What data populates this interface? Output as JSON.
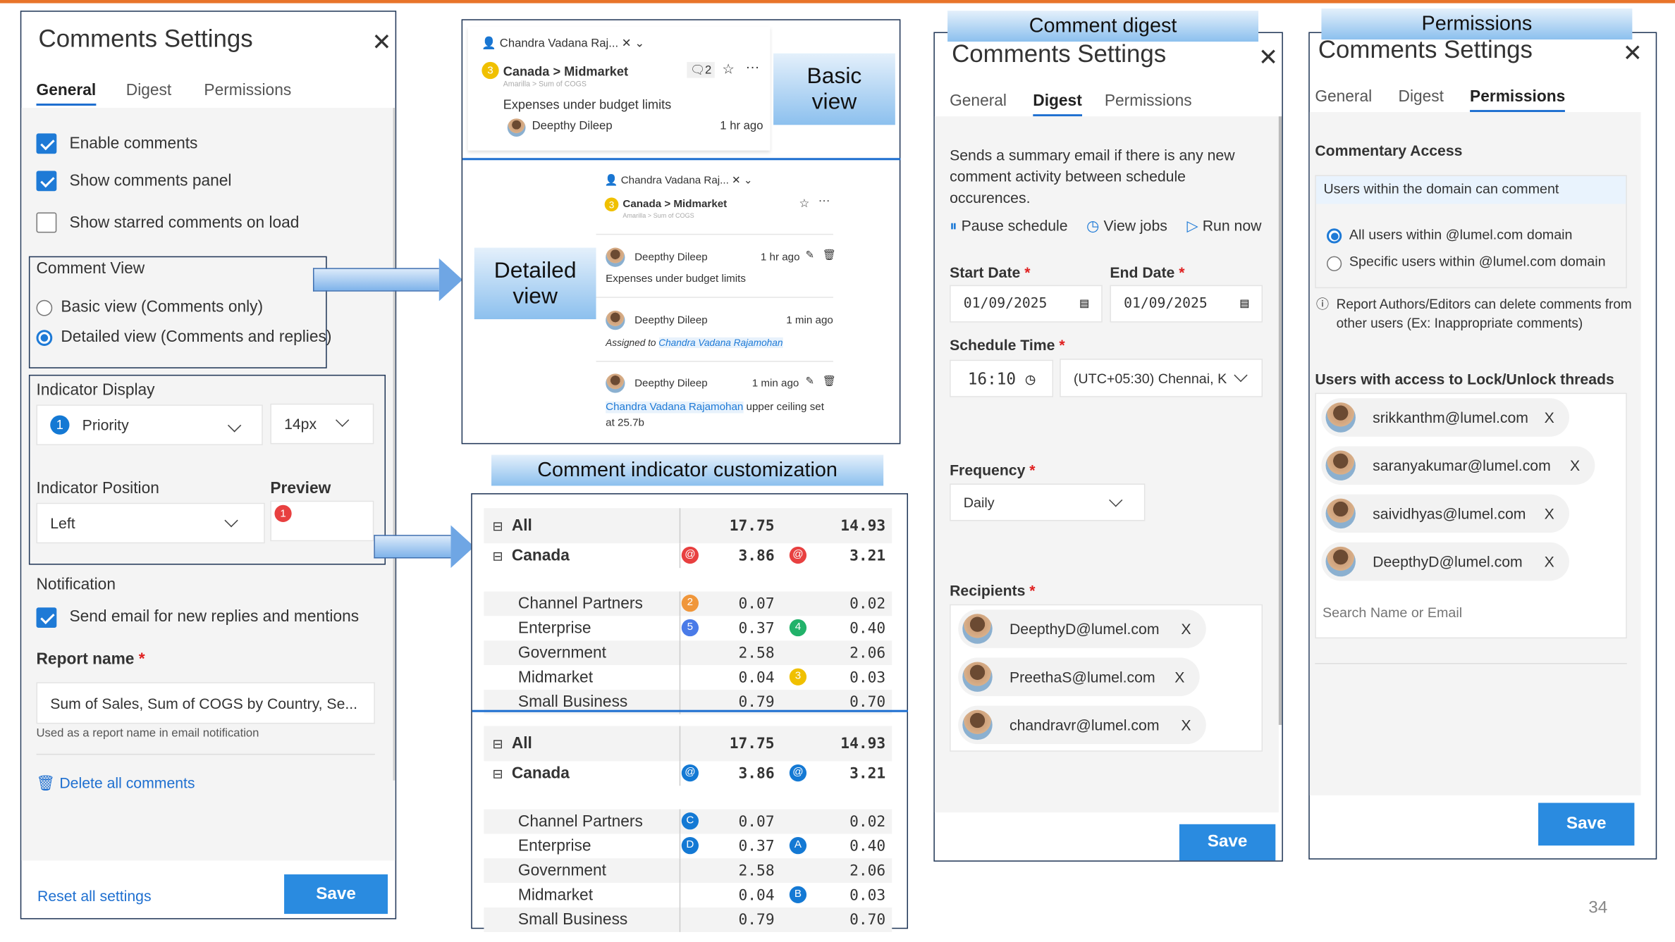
{
  "colors": {
    "accent": "#1e7ad6",
    "save": "#2a8be0",
    "top_line": "#e8742a",
    "callout": "#8cc0ee"
  },
  "general_panel": {
    "title": "Comments Settings",
    "tabs": [
      "General",
      "Digest",
      "Permissions"
    ],
    "active_tab": "General",
    "checkboxes": [
      {
        "label": "Enable comments",
        "checked": true
      },
      {
        "label": "Show comments panel",
        "checked": true
      },
      {
        "label": "Show starred comments on load",
        "checked": false
      }
    ],
    "comment_view": {
      "title": "Comment View",
      "options": [
        {
          "label": "Basic view (Comments only)",
          "selected": false
        },
        {
          "label": "Detailed view (Comments and replies)",
          "selected": true
        }
      ]
    },
    "indicator_display": {
      "title": "Indicator Display",
      "type_value": "Priority",
      "type_badge": "1",
      "size_value": "14px"
    },
    "indicator_position": {
      "title": "Indicator Position",
      "value": "Left",
      "preview_label": "Preview",
      "preview_badge": "1"
    },
    "notification": {
      "title": "Notification",
      "checkbox_label": "Send email for new replies and mentions",
      "checked": true
    },
    "report_name": {
      "label": "Report name",
      "required": "*",
      "value": "Sum of  Sales, Sum of COGS by Country, Se...",
      "hint": "Used as a report name in email notification"
    },
    "delete_all": "Delete all comments",
    "reset": "Reset all settings",
    "save": "Save"
  },
  "views": {
    "basic_label_1": "Basic",
    "basic_label_2": "view",
    "detailed_label_1": "Detailed",
    "detailed_label_2": "view",
    "assignee": "Chandra Vadana Raj...",
    "breadcrumb": "Canada > Midmarket",
    "sub_breadcrumb": "Amarilla > Sum of COGS",
    "priority_badge": "3",
    "reply_count": "2",
    "basic_comment": {
      "text": "Expenses under budget limits",
      "author": "Deepthy Dileep",
      "time": "1 hr ago"
    },
    "detailed_comments": [
      {
        "author": "Deepthy Dileep",
        "time": "1 hr ago",
        "text": "Expenses under budget limits"
      },
      {
        "author": "Deepthy Dileep",
        "time": "1 min ago",
        "prefix": "Assigned to",
        "mention": "Chandra Vadana Rajamohan"
      },
      {
        "author": "Deepthy Dileep",
        "time": "1 min ago",
        "mention": "Chandra Vadana Rajamohan",
        "text": "upper ceiling set at 25.7b"
      }
    ]
  },
  "indicator_label": "Comment indicator customization",
  "tables": [
    {
      "rows": [
        {
          "label": "All",
          "v1": "17.75",
          "v2": "14.93",
          "bold": true,
          "expander": true
        },
        {
          "label": "Canada",
          "v1": "3.86",
          "v2": "3.21",
          "bold": true,
          "expander": true,
          "b1": "@",
          "c1": "#e84040",
          "b2": "@",
          "c2": "#e84040"
        },
        {
          "label": "Channel Partners",
          "v1": "0.07",
          "v2": "0.02",
          "b1": "2",
          "c1": "#f0963a"
        },
        {
          "label": "Enterprise",
          "v1": "0.37",
          "v2": "0.40",
          "b1": "5",
          "c1": "#4a7be8",
          "b2": "4",
          "c2": "#22b26a"
        },
        {
          "label": "Government",
          "v1": "2.58",
          "v2": "2.06"
        },
        {
          "label": "Midmarket",
          "v1": "0.04",
          "v2": "0.03",
          "b2": "3",
          "c2": "#f0c000"
        },
        {
          "label": "Small Business",
          "v1": "0.79",
          "v2": "0.70"
        }
      ]
    },
    {
      "rows": [
        {
          "label": "All",
          "v1": "17.75",
          "v2": "14.93",
          "bold": true,
          "expander": true
        },
        {
          "label": "Canada",
          "v1": "3.86",
          "v2": "3.21",
          "bold": true,
          "expander": true,
          "b1": "@",
          "c1": "#1479d4",
          "b2": "@",
          "c2": "#1479d4"
        },
        {
          "label": "Channel Partners",
          "v1": "0.07",
          "v2": "0.02",
          "b1": "C",
          "c1": "#1479d4"
        },
        {
          "label": "Enterprise",
          "v1": "0.37",
          "v2": "0.40",
          "b1": "D",
          "c1": "#1479d4",
          "b2": "A",
          "c2": "#1479d4"
        },
        {
          "label": "Government",
          "v1": "2.58",
          "v2": "2.06"
        },
        {
          "label": "Midmarket",
          "v1": "0.04",
          "v2": "0.03",
          "b2": "B",
          "c2": "#1479d4"
        },
        {
          "label": "Small Business",
          "v1": "0.79",
          "v2": "0.70"
        }
      ]
    }
  ],
  "digest_panel": {
    "callout": "Comment digest",
    "title": "Comments Settings",
    "tabs": [
      "General",
      "Digest",
      "Permissions"
    ],
    "active_tab": "Digest",
    "description": "Sends a summary email if there is any new comment activity between schedule occurences.",
    "actions": [
      "Pause schedule",
      "View jobs",
      "Run now"
    ],
    "start_date_label": "Start Date",
    "start_date": "01/09/2025",
    "end_date_label": "End Date",
    "end_date": "01/09/2025",
    "schedule_time_label": "Schedule Time",
    "time": "16:10",
    "timezone": "(UTC+05:30) Chennai, K",
    "frequency_label": "Frequency",
    "frequency": "Daily",
    "recipients_label": "Recipients",
    "recipients": [
      "DeepthyD@lumel.com",
      "PreethaS@lumel.com",
      "chandravr@lumel.com"
    ],
    "remove": "X",
    "required": "*",
    "save": "Save"
  },
  "permissions_panel": {
    "callout": "Permissions",
    "title": "Comments Settings",
    "tabs": [
      "General",
      "Digest",
      "Permissions"
    ],
    "active_tab": "Permissions",
    "access_title": "Commentary Access",
    "access_header": "Users within the domain can comment",
    "options": [
      {
        "label": "All users within @lumel.com domain",
        "selected": true
      },
      {
        "label": "Specific users within @lumel.com domain",
        "selected": false
      }
    ],
    "info": "Report Authors/Editors can delete comments from other users (Ex: Inappropriate comments)",
    "lock_title": "Users with access to Lock/Unlock threads",
    "users": [
      "srikkanthm@lumel.com",
      "saranyakumar@lumel.com",
      "saividhyas@lumel.com",
      "DeepthyD@lumel.com"
    ],
    "remove": "X",
    "search_placeholder": "Search Name or Email",
    "save": "Save"
  },
  "page_number": "34"
}
